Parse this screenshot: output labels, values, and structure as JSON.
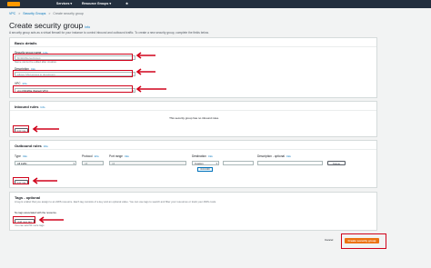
{
  "topbar": {
    "services": "Services",
    "resource_groups": "Resource Groups",
    "chevron": "▾",
    "star": "★"
  },
  "breadcrumb": [
    "VPC",
    "Security Groups",
    "Create security group"
  ],
  "breadcrumb_separator": ">",
  "page": {
    "title": "Create security group",
    "info": "Info",
    "description": "A security group acts as a virtual firewall for your instance to control inbound and outbound traffic. To create a new security group, complete the fields below."
  },
  "basic_details": {
    "title": "Basic details",
    "name_label": "Security group name",
    "name_info": "Info",
    "name_placeholder": "MyWebServerGroup",
    "name_hint": "Name cannot be edited after creation.",
    "description_label": "Description",
    "description_info": "Info",
    "description_placeholder": "Allows SSH access to developers",
    "vpc_label": "VPC",
    "vpc_info": "Info",
    "vpc_value": "vpc-0f1b2f9a (Default VPC)"
  },
  "inbound": {
    "title": "Inbound rules",
    "info": "Info",
    "empty_text": "This security group has no inbound rules.",
    "add_rule": "Add rule"
  },
  "outbound": {
    "title": "Outbound rules",
    "info": "Info",
    "columns": [
      "Type",
      "Protocol",
      "Port range",
      "Destination",
      "Description - optional"
    ],
    "column_info": "Info",
    "row": {
      "type": "All traffic",
      "protocol": "All",
      "port_range": "All",
      "destination": "Custom",
      "destination_cidr": "0.0.0.0/0",
      "description": "",
      "delete": "Delete"
    },
    "add_rule": "Add rule"
  },
  "tags": {
    "title": "Tags - optional",
    "description": "A tag is a label that you assign to an AWS resource. Each tag consists of a key and an optional value. You can use tags to search and filter your resources or track your AWS costs.",
    "empty_text": "No tags associated with the resource.",
    "add_tag": "Add new tag",
    "hint": "You can add 50 more tags"
  },
  "footer": {
    "cancel": "Cancel",
    "create": "Create security group"
  },
  "colors": {
    "annotation_red": "#d0021b",
    "primary_orange": "#ec7211",
    "nav_dark": "#232f3e",
    "link_blue": "#0073bb"
  }
}
